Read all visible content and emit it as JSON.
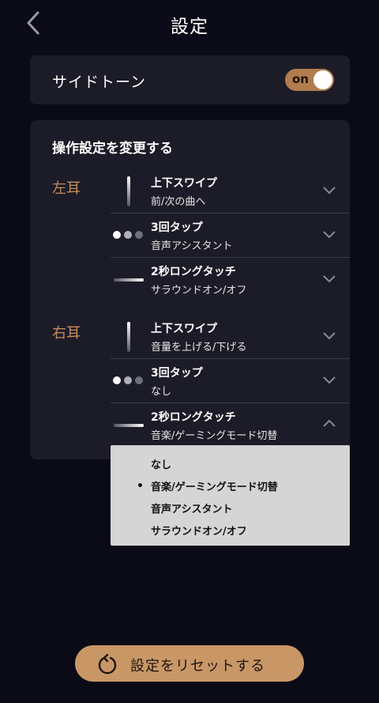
{
  "header": {
    "title": "設定",
    "back_icon": "chevron-left-icon"
  },
  "sidetone": {
    "label": "サイドトーン",
    "toggle_text": "on",
    "enabled": true
  },
  "operations": {
    "title": "操作設定を変更する",
    "left": {
      "label": "左耳",
      "rows": [
        {
          "name": "上下スワイプ",
          "value": "前/次の曲へ",
          "icon": "swipe-icon"
        },
        {
          "name": "3回タップ",
          "value": "音声アシスタント",
          "icon": "triple-tap-icon"
        },
        {
          "name": "2秒ロングタッチ",
          "value": "サラウンドオン/オフ",
          "icon": "long-touch-icon"
        }
      ]
    },
    "right": {
      "label": "右耳",
      "rows": [
        {
          "name": "上下スワイプ",
          "value": "音量を上げる/下げる",
          "icon": "swipe-icon"
        },
        {
          "name": "3回タップ",
          "value": "なし",
          "icon": "triple-tap-icon"
        },
        {
          "name": "2秒ロングタッチ",
          "value": "音楽/ゲーミングモード切替",
          "icon": "long-touch-icon"
        }
      ]
    }
  },
  "dropdown": {
    "options": [
      "なし",
      "音楽/ゲーミングモード切替",
      "音声アシスタント",
      "サラウンドオン/オフ"
    ],
    "selected": "音楽/ゲーミングモード切替"
  },
  "reset": {
    "label": "設定をリセットする",
    "icon": "reset-icon"
  },
  "colors": {
    "background": "#0a0b16",
    "card": "#1c1c28",
    "accent": "#c68b5a",
    "button": "#c99766"
  }
}
